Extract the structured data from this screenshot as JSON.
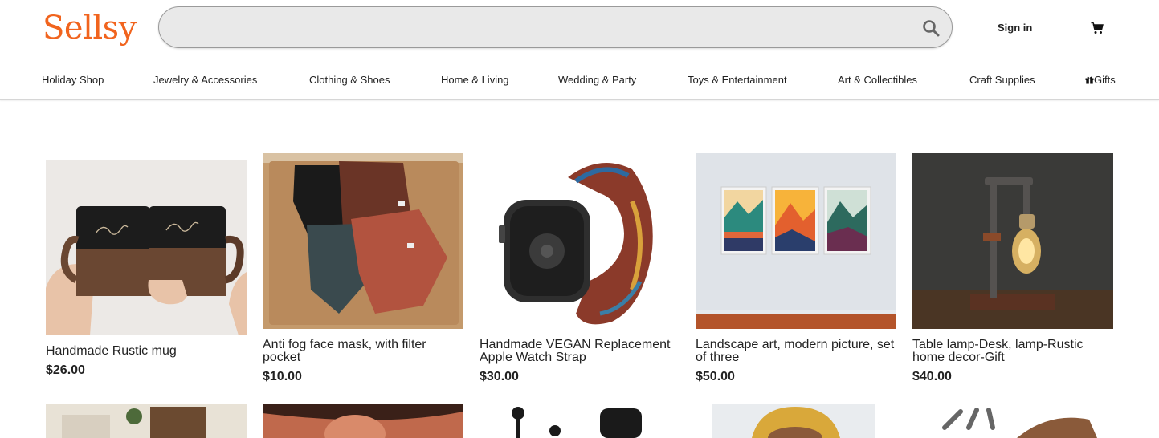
{
  "header": {
    "logo": "Sellsy",
    "search": {
      "placeholder": "",
      "value": ""
    },
    "sign_in": "Sign in"
  },
  "nav": {
    "items": [
      {
        "label": "Holiday Shop"
      },
      {
        "label": "Jewelry & Accessories"
      },
      {
        "label": "Clothing & Shoes"
      },
      {
        "label": "Home & Living"
      },
      {
        "label": "Wedding & Party"
      },
      {
        "label": "Toys & Entertainment"
      },
      {
        "label": "Art & Collectibles"
      },
      {
        "label": "Craft Supplies"
      },
      {
        "label": "Gifts",
        "icon": "gift-icon"
      }
    ]
  },
  "products": [
    {
      "title": "Handmade Rustic mug",
      "price": "$26.00"
    },
    {
      "title": "Anti fog face mask, with filter pocket",
      "price": "$10.00"
    },
    {
      "title": "Handmade VEGAN Replacement Apple Watch Strap",
      "price": "$30.00"
    },
    {
      "title": "Landscape art, modern picture, set of three",
      "price": "$50.00"
    },
    {
      "title": "Table lamp-Desk, lamp-Rustic home decor-Gift",
      "price": "$40.00"
    }
  ],
  "icons": {
    "search": "search-icon",
    "cart": "cart-icon",
    "gift": "gift-icon"
  },
  "colors": {
    "brand": "#f1641e",
    "search_bg": "#e9e9e9",
    "text": "#222222"
  }
}
